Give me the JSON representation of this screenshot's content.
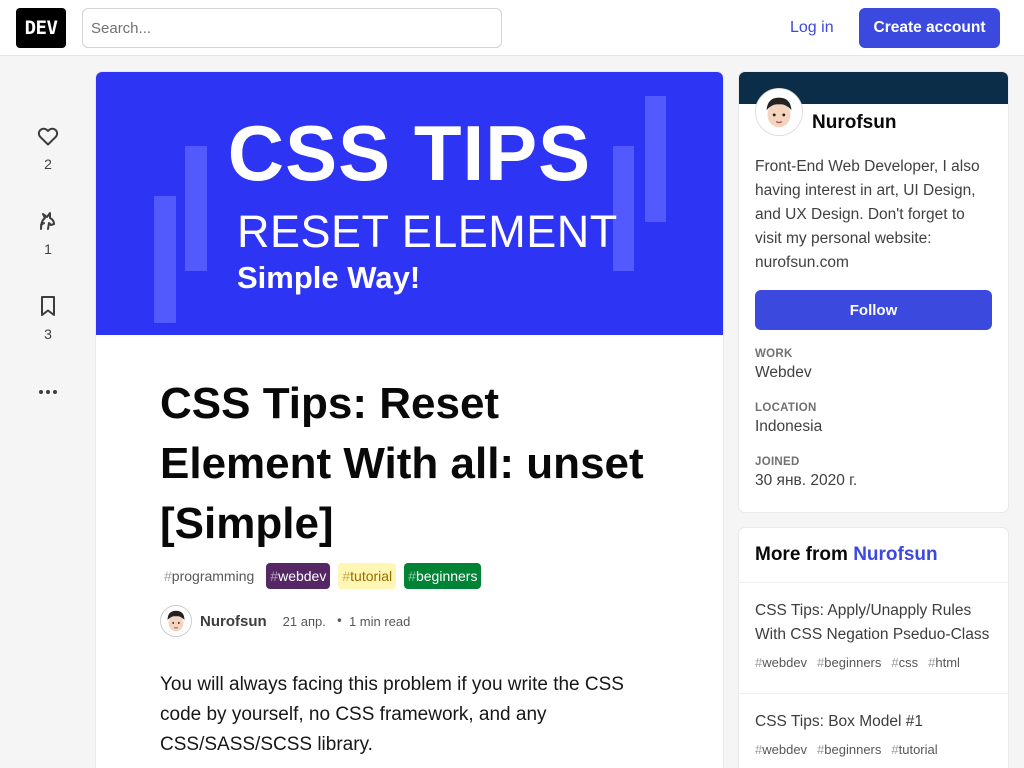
{
  "header": {
    "logo": "DEV",
    "search_placeholder": "Search...",
    "login_label": "Log in",
    "create_account_label": "Create account"
  },
  "reactions": [
    {
      "icon": "heart-icon",
      "count": "2"
    },
    {
      "icon": "unicorn-icon",
      "count": "1"
    },
    {
      "icon": "bookmark-icon",
      "count": "3"
    }
  ],
  "more_icon": "ellipsis-icon",
  "article": {
    "cover": {
      "line1": "CSS TIPS",
      "line2": "RESET ELEMENT",
      "line3": "Simple Way!",
      "bg_color": "#2e34f3"
    },
    "title": "CSS Tips: Reset Element With all: unset [Simple]",
    "tags": [
      {
        "hash": "#",
        "label": "programming",
        "bg": "transparent",
        "color": "#575757"
      },
      {
        "hash": "#",
        "label": "webdev",
        "bg": "#562765",
        "color": "#ffffff"
      },
      {
        "hash": "#",
        "label": "tutorial",
        "bg": "#fef6b3",
        "color": "#b8860b"
      },
      {
        "hash": "#",
        "label": "beginners",
        "bg": "#008335",
        "color": "#ffffff"
      }
    ],
    "author": "Nurofsun",
    "date": "21 апр.",
    "separator": "•",
    "read_time": "1 min read",
    "body": "You will always facing this problem if you write the CSS code by yourself, no CSS framework, and any CSS/SASS/SCSS library."
  },
  "profile": {
    "brand_color": "#0c2d48",
    "name": "Nurofsun",
    "bio": "Front-End Web Developer, I also having interest in art, UI Design, and UX Design. Don't forget to visit my personal website: nurofsun.com",
    "follow_label": "Follow",
    "work_label": "WORK",
    "work_value": "Webdev",
    "location_label": "LOCATION",
    "location_value": "Indonesia",
    "joined_label": "JOINED",
    "joined_value": "30 янв. 2020 г."
  },
  "more_from": {
    "prefix": "More from",
    "author": "Nurofsun",
    "items": [
      {
        "title": "CSS Tips: Apply/Unapply Rules With CSS Negation Pseduo-Class",
        "tags": [
          "webdev",
          "beginners",
          "css",
          "html"
        ]
      },
      {
        "title": "CSS Tips: Box Model #1",
        "tags": [
          "webdev",
          "beginners",
          "tutorial"
        ]
      }
    ]
  },
  "colors": {
    "accent": "#3b49df",
    "page_bg": "#f5f5f5"
  }
}
